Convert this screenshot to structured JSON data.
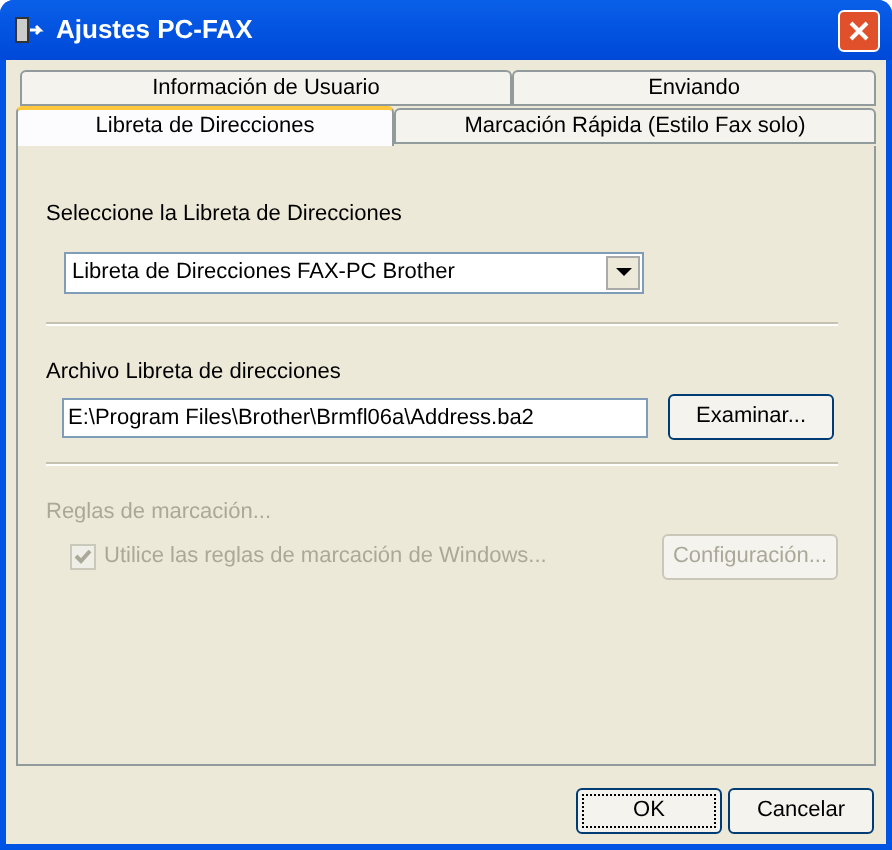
{
  "window": {
    "title": "Ajustes PC-FAX"
  },
  "tab_rows": [
    [
      {
        "label": "Información de Usuario",
        "selected": false
      },
      {
        "label": "Enviando",
        "selected": false
      }
    ],
    [
      {
        "label": "Libreta de Direcciones",
        "selected": true
      },
      {
        "label": "Marcación Rápida (Estilo Fax solo)",
        "selected": false
      }
    ]
  ],
  "address_book": {
    "label": "Seleccione la Libreta de Direcciones",
    "value": "Libreta de Direcciones FAX-PC Brother"
  },
  "address_file": {
    "label": "Archivo Libreta de direcciones",
    "value": "E:\\Program Files\\Brother\\Brmfl06a\\Address.ba2",
    "button": "Examinar..."
  },
  "dialing_rules": {
    "label": "Reglas de marcación...",
    "disabled": true,
    "checkbox": {
      "label": "Utilice las reglas de marcación de Windows...",
      "checked": true
    },
    "button": "Configuración..."
  },
  "buttons": [
    {
      "label": "OK",
      "focused": true
    },
    {
      "label": "Cancelar",
      "focused": false
    }
  ]
}
